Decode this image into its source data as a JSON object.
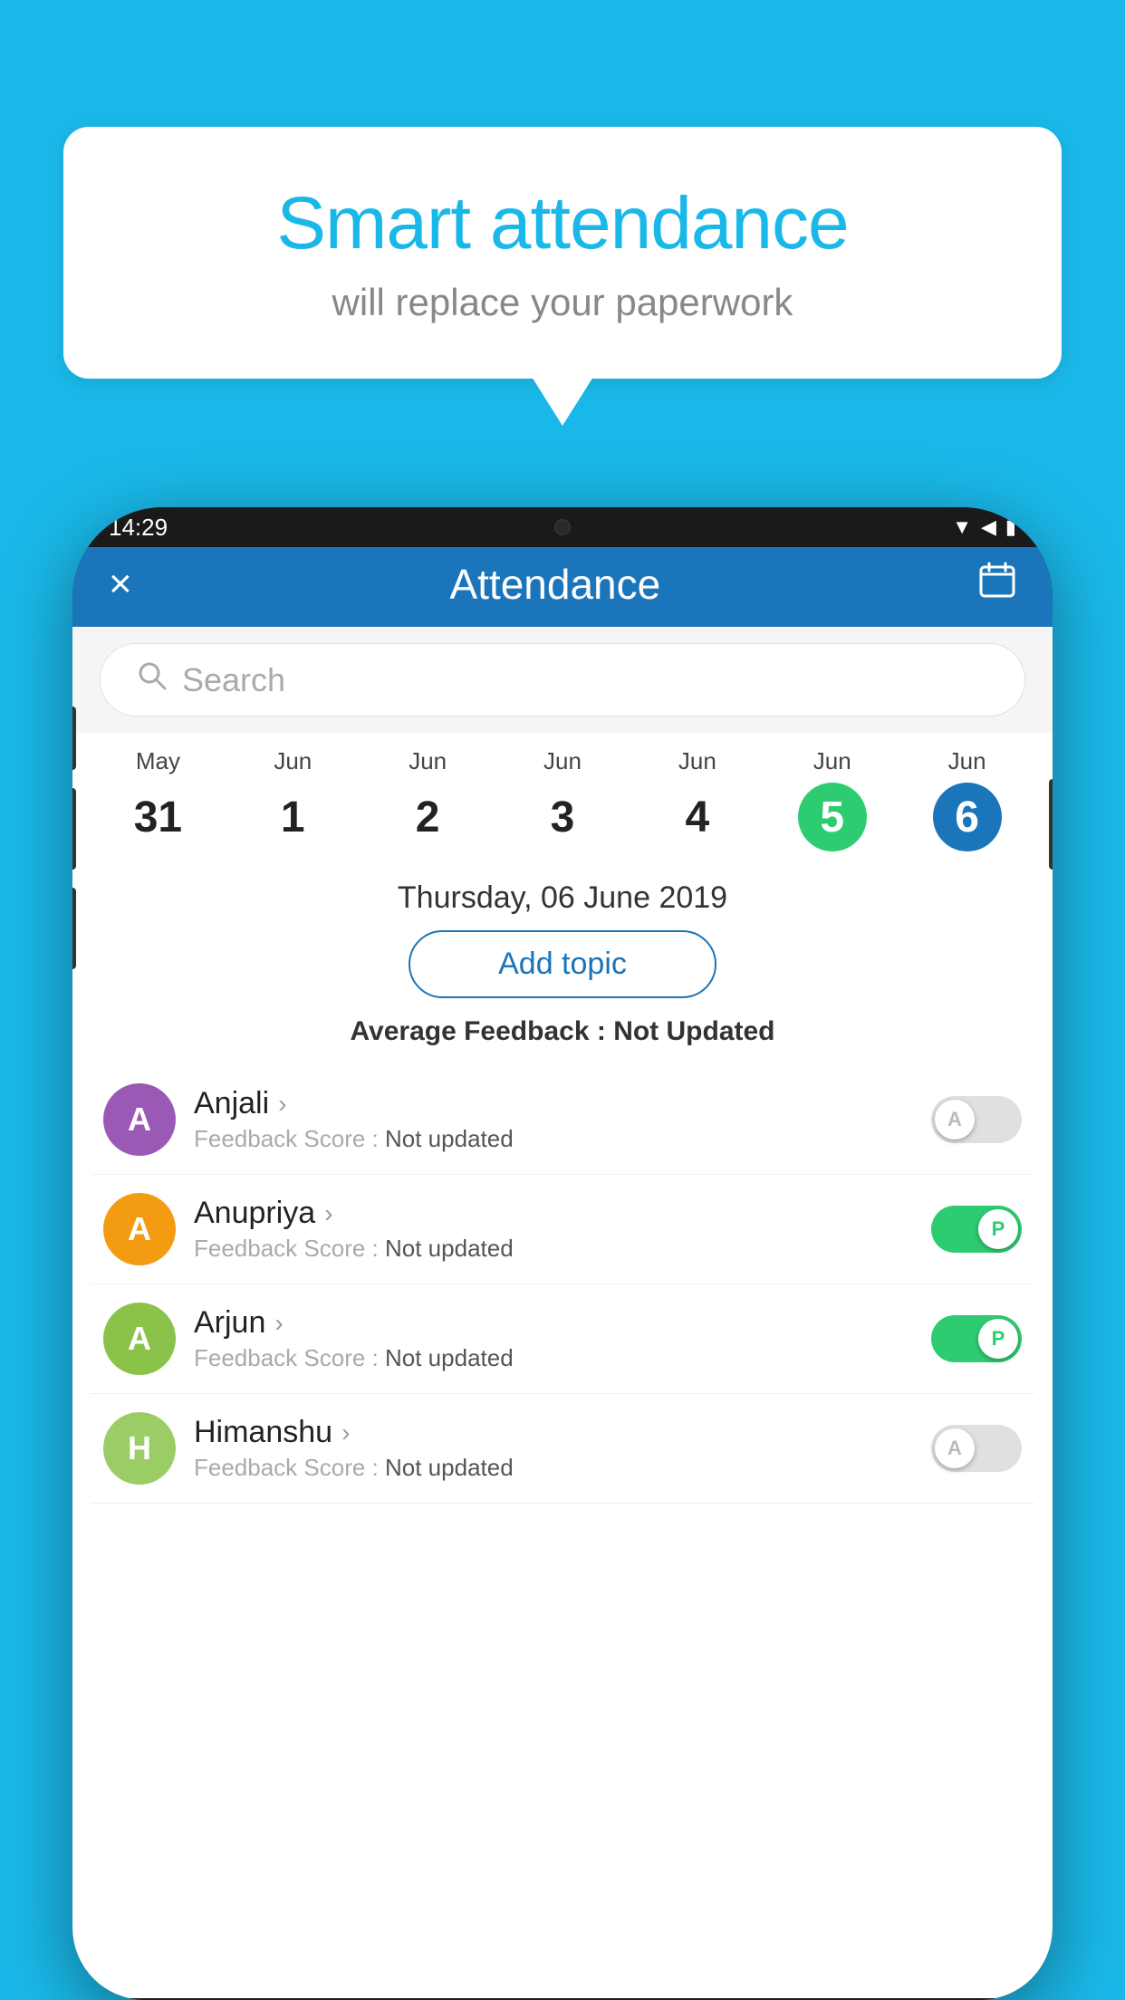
{
  "background_color": "#1ab8e8",
  "bubble": {
    "title": "Smart attendance",
    "subtitle": "will replace your paperwork"
  },
  "status_bar": {
    "time": "14:29",
    "icons": [
      "wifi",
      "signal",
      "battery"
    ]
  },
  "header": {
    "title": "Attendance",
    "close_label": "×",
    "calendar_icon": "📅"
  },
  "search": {
    "placeholder": "Search"
  },
  "dates": [
    {
      "month": "May",
      "day": "31",
      "state": "normal"
    },
    {
      "month": "Jun",
      "day": "1",
      "state": "normal"
    },
    {
      "month": "Jun",
      "day": "2",
      "state": "normal"
    },
    {
      "month": "Jun",
      "day": "3",
      "state": "normal"
    },
    {
      "month": "Jun",
      "day": "4",
      "state": "normal"
    },
    {
      "month": "Jun",
      "day": "5",
      "state": "today"
    },
    {
      "month": "Jun",
      "day": "6",
      "state": "selected"
    }
  ],
  "selected_date": "Thursday, 06 June 2019",
  "add_topic_label": "Add topic",
  "avg_feedback_label": "Average Feedback :",
  "avg_feedback_value": "Not Updated",
  "students": [
    {
      "name": "Anjali",
      "avatar_letter": "A",
      "avatar_color": "#9b59b6",
      "feedback_label": "Feedback Score :",
      "feedback_value": "Not updated",
      "attendance": "absent",
      "toggle_letter": "A"
    },
    {
      "name": "Anupriya",
      "avatar_letter": "A",
      "avatar_color": "#f39c12",
      "feedback_label": "Feedback Score :",
      "feedback_value": "Not updated",
      "attendance": "present",
      "toggle_letter": "P"
    },
    {
      "name": "Arjun",
      "avatar_letter": "A",
      "avatar_color": "#8bc34a",
      "feedback_label": "Feedback Score :",
      "feedback_value": "Not updated",
      "attendance": "present",
      "toggle_letter": "P"
    },
    {
      "name": "Himanshu",
      "avatar_letter": "H",
      "avatar_color": "#9ccc65",
      "feedback_label": "Feedback Score :",
      "feedback_value": "Not updated",
      "attendance": "absent",
      "toggle_letter": "A"
    }
  ]
}
